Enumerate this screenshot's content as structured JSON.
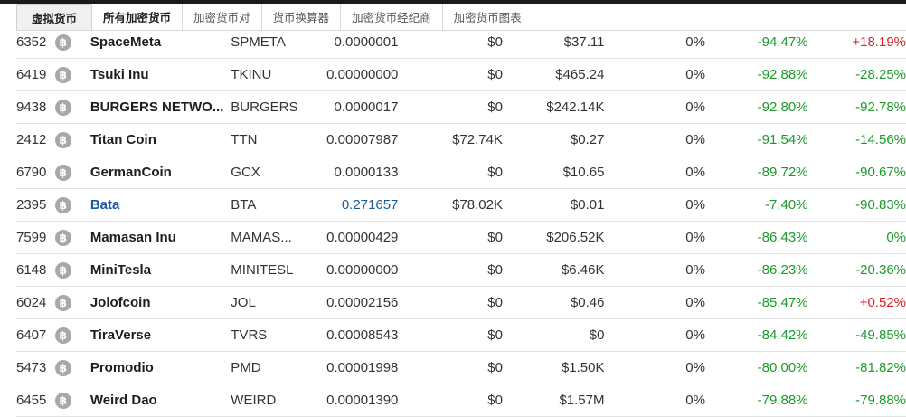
{
  "tabs": [
    {
      "label": "虚拟货币"
    },
    {
      "label": "所有加密货币"
    },
    {
      "label": "加密货币对"
    },
    {
      "label": "货币换算器"
    },
    {
      "label": "加密货币经纪商"
    },
    {
      "label": "加密货币图表"
    }
  ],
  "coin_icon": "ฺB",
  "rows": [
    {
      "rank": "6352",
      "name": "SpaceMeta",
      "symbol": "SPMETA",
      "price": "0.0000001",
      "volume": "$0",
      "cap": "$37.11",
      "pct": "0%",
      "ch24": "-94.47%",
      "ch7": "+18.19%"
    },
    {
      "rank": "6419",
      "name": "Tsuki Inu",
      "symbol": "TKINU",
      "price": "0.00000000",
      "volume": "$0",
      "cap": "$465.24",
      "pct": "0%",
      "ch24": "-92.88%",
      "ch7": "-28.25%"
    },
    {
      "rank": "9438",
      "name": "BURGERS NETWO...",
      "symbol": "BURGERS",
      "price": "0.0000017",
      "volume": "$0",
      "cap": "$242.14K",
      "pct": "0%",
      "ch24": "-92.80%",
      "ch7": "-92.78%"
    },
    {
      "rank": "2412",
      "name": "Titan Coin",
      "symbol": "TTN",
      "price": "0.00007987",
      "volume": "$72.74K",
      "cap": "$0.27",
      "pct": "0%",
      "ch24": "-91.54%",
      "ch7": "-14.56%"
    },
    {
      "rank": "6790",
      "name": "GermanCoin",
      "symbol": "GCX",
      "price": "0.0000133",
      "volume": "$0",
      "cap": "$10.65",
      "pct": "0%",
      "ch24": "-89.72%",
      "ch7": "-90.67%"
    },
    {
      "rank": "2395",
      "name": "Bata",
      "symbol": "BTA",
      "price": "0.271657",
      "volume": "$78.02K",
      "cap": "$0.01",
      "pct": "0%",
      "ch24": "-7.40%",
      "ch7": "-90.83%"
    },
    {
      "rank": "7599",
      "name": "Mamasan Inu",
      "symbol": "MAMAS...",
      "price": "0.00000429",
      "volume": "$0",
      "cap": "$206.52K",
      "pct": "0%",
      "ch24": "-86.43%",
      "ch7": "0%"
    },
    {
      "rank": "6148",
      "name": "MiniTesla",
      "symbol": "MINITESL",
      "price": "0.00000000",
      "volume": "$0",
      "cap": "$6.46K",
      "pct": "0%",
      "ch24": "-86.23%",
      "ch7": "-20.36%"
    },
    {
      "rank": "6024",
      "name": "Jolofcoin",
      "symbol": "JOL",
      "price": "0.00002156",
      "volume": "$0",
      "cap": "$0.46",
      "pct": "0%",
      "ch24": "-85.47%",
      "ch7": "+0.52%"
    },
    {
      "rank": "6407",
      "name": "TiraVerse",
      "symbol": "TVRS",
      "price": "0.00008543",
      "volume": "$0",
      "cap": "$0",
      "pct": "0%",
      "ch24": "-84.42%",
      "ch7": "-49.85%"
    },
    {
      "rank": "5473",
      "name": "Promodio",
      "symbol": "PMD",
      "price": "0.00001998",
      "volume": "$0",
      "cap": "$1.50K",
      "pct": "0%",
      "ch24": "-80.00%",
      "ch7": "-81.82%"
    },
    {
      "rank": "6455",
      "name": "Weird Dao",
      "symbol": "WEIRD",
      "price": "0.00001390",
      "volume": "$0",
      "cap": "$1.57M",
      "pct": "0%",
      "ch24": "-79.88%",
      "ch7": "-79.88%"
    }
  ],
  "colors": {
    "green": "#1b9a2b",
    "red": "#dd1e28",
    "link": "#1a5a9c"
  }
}
